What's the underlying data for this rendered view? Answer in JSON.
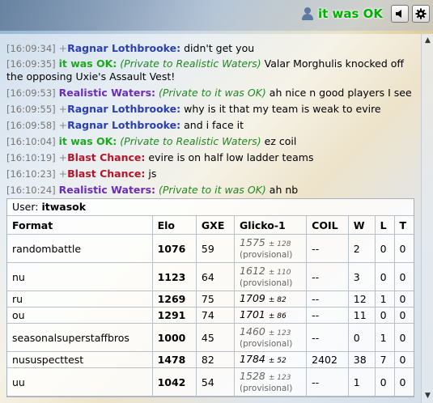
{
  "topbar": {
    "username": "it was OK",
    "sound_icon": "speaker-icon",
    "settings_icon": "gear-icon"
  },
  "messages": [
    {
      "time": "[16:09:34]",
      "rank": "+",
      "user": "Ragnar Lothbrooke:",
      "color": "#2a3fb0",
      "text": "didn't get you",
      "pm": ""
    },
    {
      "time": "[16:09:35]",
      "rank": "",
      "user": "it was OK:",
      "color": "#1ea81e",
      "pm": "(Private to Realistic Waters)",
      "text": "Valar Morghulis knocked off the opposing Uxie's Assault Vest!"
    },
    {
      "time": "[16:09:53]",
      "rank": "",
      "user": "Realistic Waters:",
      "color": "#6b2db3",
      "pm": "(Private to it was OK)",
      "text": "ah nice n good players I see"
    },
    {
      "time": "[16:09:55]",
      "rank": "+",
      "user": "Ragnar Lothbrooke:",
      "color": "#2a3fb0",
      "text": "why is it that my team is weak to evire",
      "pm": ""
    },
    {
      "time": "[16:09:58]",
      "rank": "+",
      "user": "Ragnar Lothbrooke:",
      "color": "#2a3fb0",
      "text": "and i face it",
      "pm": ""
    },
    {
      "time": "[16:10:04]",
      "rank": "",
      "user": "it was OK:",
      "color": "#1ea81e",
      "pm": "(Private to Realistic Waters)",
      "text": "ez coil"
    },
    {
      "time": "[16:10:19]",
      "rank": "+",
      "user": "Blast Chance:",
      "color": "#b3162a",
      "text": "evire is on half low ladder teams",
      "pm": ""
    },
    {
      "time": "[16:10:23]",
      "rank": "+",
      "user": "Blast Chance:",
      "color": "#b3162a",
      "text": "js",
      "pm": ""
    },
    {
      "time": "[16:10:24]",
      "rank": "",
      "user": "Realistic Waters:",
      "color": "#6b2db3",
      "pm": "(Private to it was OK)",
      "text": "ah nb"
    }
  ],
  "ranking": {
    "user_label": "User:",
    "user_name": "itwasok",
    "headers": [
      "Format",
      "Elo",
      "GXE",
      "Glicko-1",
      "COIL",
      "W",
      "L",
      "T"
    ],
    "pm_symbol": "±",
    "provisional_label": "(provisional)",
    "rows": [
      {
        "format": "randombattle",
        "elo": "1076",
        "gxe": "59",
        "glicko": "1575",
        "dev": "128",
        "provisional": true,
        "coil": "--",
        "w": "2",
        "l": "0",
        "t": "0"
      },
      {
        "format": "nu",
        "elo": "1123",
        "gxe": "64",
        "glicko": "1612",
        "dev": "110",
        "provisional": true,
        "coil": "--",
        "w": "3",
        "l": "0",
        "t": "0"
      },
      {
        "format": "ru",
        "elo": "1269",
        "gxe": "75",
        "glicko": "1709",
        "dev": "82",
        "provisional": false,
        "coil": "--",
        "w": "12",
        "l": "1",
        "t": "0"
      },
      {
        "format": "ou",
        "elo": "1291",
        "gxe": "74",
        "glicko": "1701",
        "dev": "86",
        "provisional": false,
        "coil": "--",
        "w": "11",
        "l": "0",
        "t": "0"
      },
      {
        "format": "seasonalsuperstaffbros",
        "elo": "1000",
        "gxe": "45",
        "glicko": "1460",
        "dev": "123",
        "provisional": true,
        "coil": "--",
        "w": "0",
        "l": "1",
        "t": "0"
      },
      {
        "format": "nususpecttest",
        "elo": "1478",
        "gxe": "82",
        "glicko": "1784",
        "dev": "52",
        "provisional": false,
        "coil": "2402",
        "w": "38",
        "l": "7",
        "t": "0"
      },
      {
        "format": "uu",
        "elo": "1042",
        "gxe": "54",
        "glicko": "1528",
        "dev": "123",
        "provisional": true,
        "coil": "--",
        "w": "1",
        "l": "0",
        "t": "0"
      }
    ]
  }
}
